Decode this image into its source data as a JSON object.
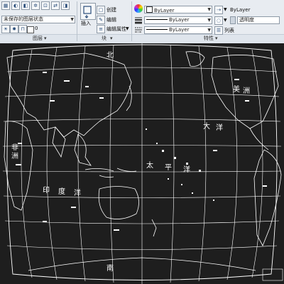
{
  "ribbon": {
    "layers": {
      "state_combo": "未保存的图层状态",
      "layer_combo": "0",
      "title": "图层"
    },
    "block": {
      "insert_label": "插入",
      "create_label": "创建",
      "edit_label": "编辑",
      "edit_attr_label": "编辑属性",
      "title": "块"
    },
    "properties": {
      "color_combo": "ByLayer",
      "linetype_combo": "ByLayer",
      "lineweight_combo": "ByLayer",
      "right_combo": "ByLayer",
      "transparency_label": "透明度",
      "list_label": "列表",
      "title": "特性"
    }
  },
  "map": {
    "labels": [
      "太",
      "平",
      "洋",
      "印",
      "度",
      "洋",
      "大",
      "洋",
      "南",
      "北",
      "美",
      "洲",
      "非",
      "洲"
    ]
  },
  "colors": {
    "drawing_bg": "#1e1e1e",
    "linework": "#ffffff",
    "ribbon_bg": "#e8ecf1"
  }
}
